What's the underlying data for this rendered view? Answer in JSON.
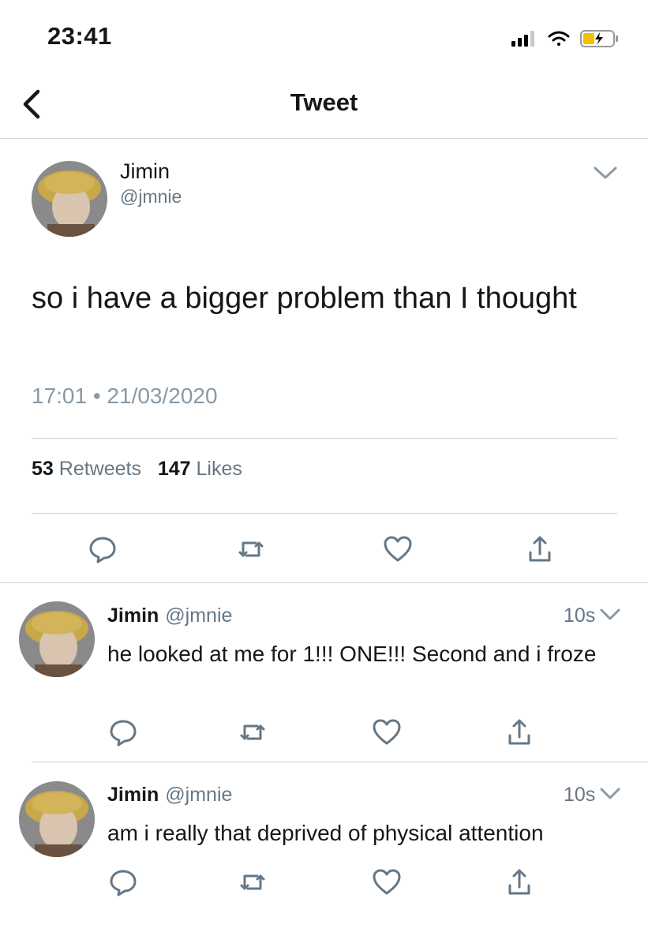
{
  "status_bar": {
    "time": "23:41"
  },
  "nav": {
    "title": "Tweet"
  },
  "main_tweet": {
    "name": "Jimin",
    "handle": "@jmnie",
    "text": "so i have a bigger problem than I thought",
    "timestamp": "17:01 • 21/03/2020",
    "retweets_count": "53",
    "retweets_label": " Retweets",
    "likes_count": "147",
    "likes_label": " Likes"
  },
  "replies": [
    {
      "name": "Jimin",
      "handle": "@jmnie",
      "age": "10s",
      "text": "he looked at me for 1!!! ONE!!! Second and i froze"
    },
    {
      "name": "Jimin",
      "handle": "@jmnie",
      "age": "10s",
      "text": "am i really that deprived of physical attention"
    }
  ],
  "icons": {
    "reply": "reply-icon",
    "retweet": "retweet-icon",
    "like": "heart-icon",
    "share": "share-icon",
    "back": "back-chevron-icon",
    "more": "chevron-down-icon"
  },
  "colors": {
    "text": "#14171a",
    "secondary": "#657786",
    "icon": "#657786",
    "divider": "#cfd4d9"
  }
}
